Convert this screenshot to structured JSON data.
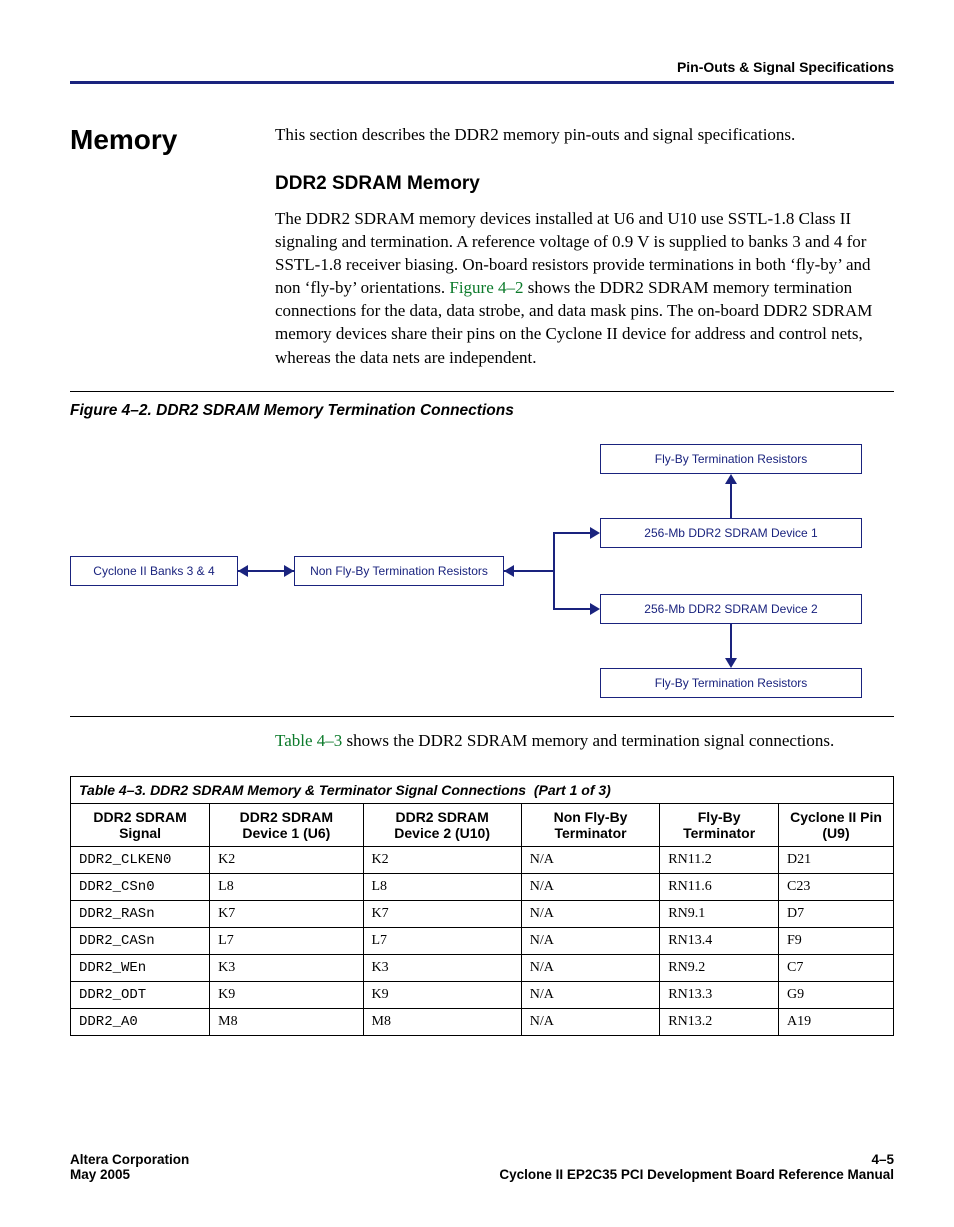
{
  "header": {
    "right": "Pin-Outs & Signal Specifications"
  },
  "section": {
    "title": "Memory",
    "intro": "This section describes the DDR2 memory pin-outs and signal specifications.",
    "sub_title": "DDR2 SDRAM Memory",
    "body_before_link": "The DDR2 SDRAM memory devices installed at U6 and U10 use SSTL-1.8 Class II signaling and termination. A reference voltage of 0.9 V is supplied to banks 3 and 4 for SSTL-1.8 receiver biasing. On-board resistors provide terminations in both ‘fly-by’ and non ‘fly-by’ orientations. ",
    "link1": "Figure 4–2",
    "body_after_link": " shows the DDR2 SDRAM memory termination connections for the data, data strobe, and data mask pins. The on-board DDR2 SDRAM memory devices share their pins on the Cyclone II device for address and control nets, whereas the data nets are independent."
  },
  "figure": {
    "caption": "Figure 4–2. DDR2 SDRAM Memory Termination Connections",
    "boxes": {
      "cyclone": "Cyclone II Banks 3 & 4",
      "nonfly": "Non Fly-By Termination Resistors",
      "flyby_top": "Fly-By Termination Resistors",
      "dev1": "256-Mb DDR2 SDRAM Device 1",
      "dev2": "256-Mb DDR2 SDRAM Device 2",
      "flyby_bot": "Fly-By Termination Resistors"
    }
  },
  "table_intro": {
    "link": "Table 4–3",
    "rest": " shows the DDR2 SDRAM memory and termination signal connections."
  },
  "table": {
    "caption": "Table 4–3. DDR2 SDRAM Memory & Terminator Signal Connections  (Part 1 of 3)",
    "headers": [
      "DDR2 SDRAM Signal",
      "DDR2 SDRAM Device 1 (U6)",
      "DDR2 SDRAM Device 2 (U10)",
      "Non Fly-By Terminator",
      "Fly-By Terminator",
      "Cyclone II Pin (U9)"
    ],
    "rows": [
      {
        "sig": "DDR2_CLKEN0",
        "d1": "K2",
        "d2": "K2",
        "nfb": "N/A",
        "fb": "RN11.2",
        "pin": "D21"
      },
      {
        "sig": "DDR2_CSn0",
        "d1": "L8",
        "d2": "L8",
        "nfb": "N/A",
        "fb": "RN11.6",
        "pin": "C23"
      },
      {
        "sig": "DDR2_RASn",
        "d1": "K7",
        "d2": "K7",
        "nfb": "N/A",
        "fb": "RN9.1",
        "pin": "D7"
      },
      {
        "sig": "DDR2_CASn",
        "d1": "L7",
        "d2": "L7",
        "nfb": "N/A",
        "fb": "RN13.4",
        "pin": "F9"
      },
      {
        "sig": "DDR2_WEn",
        "d1": "K3",
        "d2": "K3",
        "nfb": "N/A",
        "fb": "RN9.2",
        "pin": "C7"
      },
      {
        "sig": "DDR2_ODT",
        "d1": "K9",
        "d2": "K9",
        "nfb": "N/A",
        "fb": "RN13.3",
        "pin": "G9"
      },
      {
        "sig": "DDR2_A0",
        "d1": "M8",
        "d2": "M8",
        "nfb": "N/A",
        "fb": "RN13.2",
        "pin": "A19"
      }
    ]
  },
  "footer": {
    "left1": "Altera Corporation",
    "left2": "May 2005",
    "right1": "4–5",
    "right2": "Cyclone II EP2C35 PCI Development Board Reference Manual"
  }
}
